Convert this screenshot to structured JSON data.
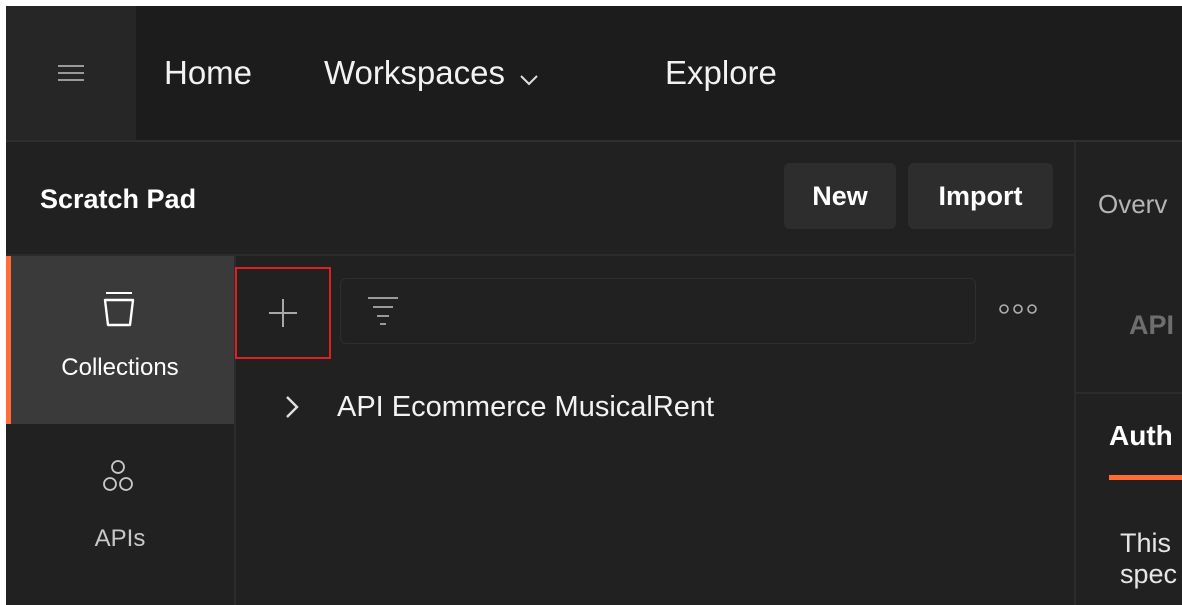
{
  "nav": {
    "home": "Home",
    "workspaces": "Workspaces",
    "explore": "Explore"
  },
  "sidebar": {
    "title": "Scratch Pad",
    "new_label": "New",
    "import_label": "Import"
  },
  "rail": {
    "items": [
      {
        "label": "Collections",
        "icon": "collections-icon",
        "active": true
      },
      {
        "label": "APIs",
        "icon": "apis-icon",
        "active": false
      }
    ]
  },
  "collections": {
    "items": [
      {
        "label": "API Ecommerce MusicalRent"
      }
    ]
  },
  "right": {
    "tab": "Overv",
    "api_heading": "API",
    "auth_tab": "Auth",
    "desc_line1": "This",
    "desc_line2": "spec"
  },
  "colors": {
    "accent": "#ff6c37",
    "highlight_box": "#e02020",
    "background": "#212121"
  }
}
